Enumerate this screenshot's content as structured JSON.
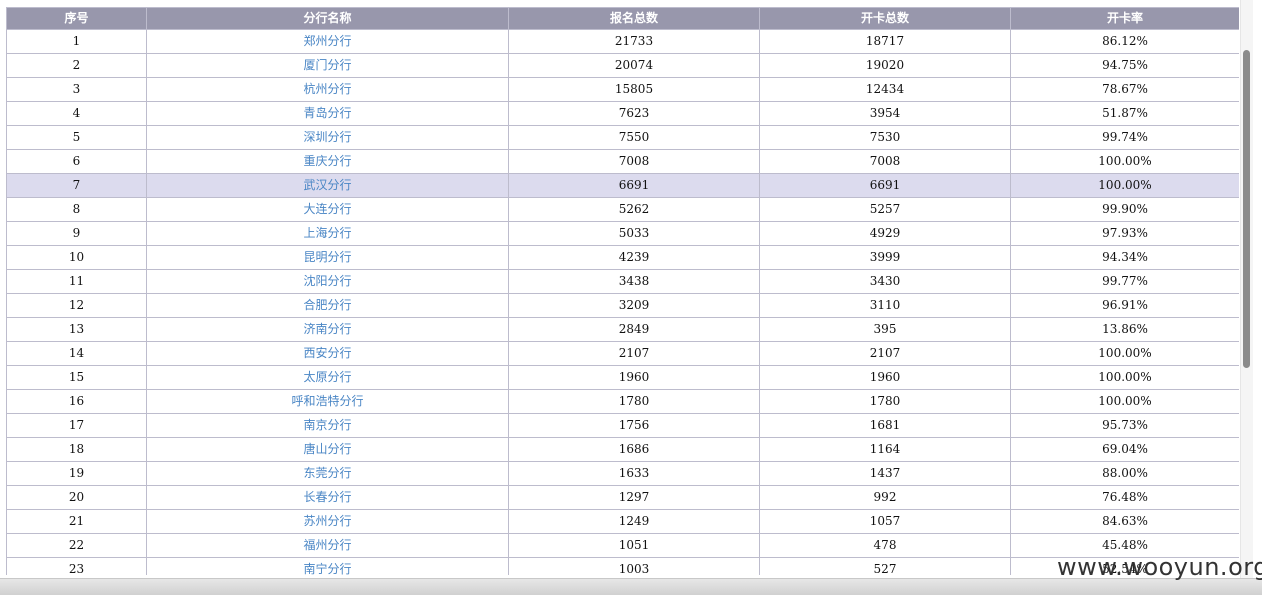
{
  "table": {
    "headers": [
      "序号",
      "分行名称",
      "报名总数",
      "开卡总数",
      "开卡率"
    ],
    "rows": [
      {
        "no": "1",
        "branch": "郑州分行",
        "signups": "21733",
        "cards": "18717",
        "rate": "86.12%"
      },
      {
        "no": "2",
        "branch": "厦门分行",
        "signups": "20074",
        "cards": "19020",
        "rate": "94.75%"
      },
      {
        "no": "3",
        "branch": "杭州分行",
        "signups": "15805",
        "cards": "12434",
        "rate": "78.67%"
      },
      {
        "no": "4",
        "branch": "青岛分行",
        "signups": "7623",
        "cards": "3954",
        "rate": "51.87%"
      },
      {
        "no": "5",
        "branch": "深圳分行",
        "signups": "7550",
        "cards": "7530",
        "rate": "99.74%"
      },
      {
        "no": "6",
        "branch": "重庆分行",
        "signups": "7008",
        "cards": "7008",
        "rate": "100.00%"
      },
      {
        "no": "7",
        "branch": "武汉分行",
        "signups": "6691",
        "cards": "6691",
        "rate": "100.00%",
        "highlight": true
      },
      {
        "no": "8",
        "branch": "大连分行",
        "signups": "5262",
        "cards": "5257",
        "rate": "99.90%"
      },
      {
        "no": "9",
        "branch": "上海分行",
        "signups": "5033",
        "cards": "4929",
        "rate": "97.93%"
      },
      {
        "no": "10",
        "branch": "昆明分行",
        "signups": "4239",
        "cards": "3999",
        "rate": "94.34%"
      },
      {
        "no": "11",
        "branch": "沈阳分行",
        "signups": "3438",
        "cards": "3430",
        "rate": "99.77%"
      },
      {
        "no": "12",
        "branch": "合肥分行",
        "signups": "3209",
        "cards": "3110",
        "rate": "96.91%"
      },
      {
        "no": "13",
        "branch": "济南分行",
        "signups": "2849",
        "cards": "395",
        "rate": "13.86%"
      },
      {
        "no": "14",
        "branch": "西安分行",
        "signups": "2107",
        "cards": "2107",
        "rate": "100.00%"
      },
      {
        "no": "15",
        "branch": "太原分行",
        "signups": "1960",
        "cards": "1960",
        "rate": "100.00%"
      },
      {
        "no": "16",
        "branch": "呼和浩特分行",
        "signups": "1780",
        "cards": "1780",
        "rate": "100.00%"
      },
      {
        "no": "17",
        "branch": "南京分行",
        "signups": "1756",
        "cards": "1681",
        "rate": "95.73%"
      },
      {
        "no": "18",
        "branch": "唐山分行",
        "signups": "1686",
        "cards": "1164",
        "rate": "69.04%"
      },
      {
        "no": "19",
        "branch": "东莞分行",
        "signups": "1633",
        "cards": "1437",
        "rate": "88.00%"
      },
      {
        "no": "20",
        "branch": "长春分行",
        "signups": "1297",
        "cards": "992",
        "rate": "76.48%"
      },
      {
        "no": "21",
        "branch": "苏州分行",
        "signups": "1249",
        "cards": "1057",
        "rate": "84.63%"
      },
      {
        "no": "22",
        "branch": "福州分行",
        "signups": "1051",
        "cards": "478",
        "rate": "45.48%"
      },
      {
        "no": "23",
        "branch": "南宁分行",
        "signups": "1003",
        "cards": "527",
        "rate": "52.54%"
      }
    ]
  },
  "watermark": "www.wooyun.org",
  "colors": {
    "header_bg": "#9897ac",
    "highlight_row": "#dcdbee",
    "branch_link": "#4a86c5",
    "border": "#bdbccd"
  }
}
